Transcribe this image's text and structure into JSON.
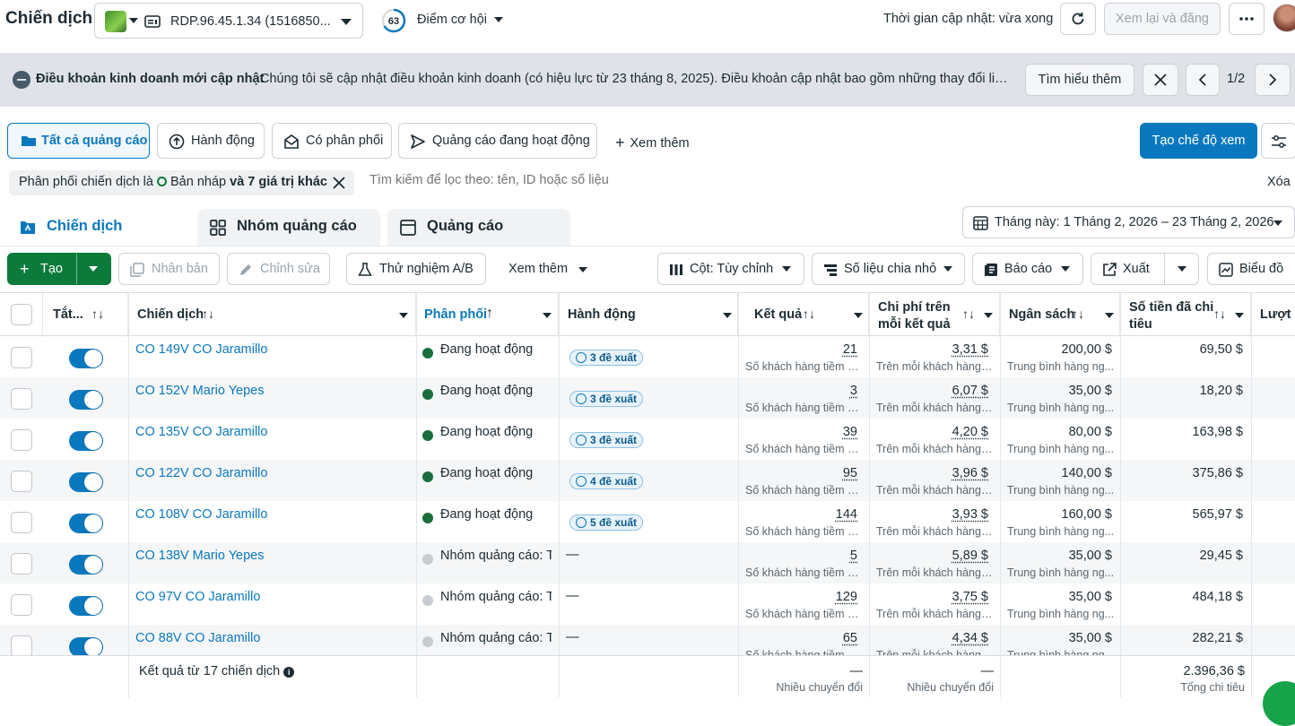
{
  "header": {
    "title": "Chiến dịch",
    "account_name": "RDP.96.45.1.34 (1516850...",
    "opportunity_score": "63",
    "opportunity_label": "Điểm cơ hội",
    "update_time": "Thời gian cập nhật: vừa xong",
    "review_publish_label": "Xem lại và đăng"
  },
  "notice": {
    "title": "Điều khoản kinh doanh mới cập nhật",
    "text": "Chúng tôi sẽ cập nhật điều khoản kinh doanh (có hiệu lực từ 23 tháng 8, 2025). Điều khoản cập nhật bao gồm những thay đổi liên q...",
    "learn_more": "Tìm hiểu thêm",
    "page": "1/2"
  },
  "views": {
    "all_ads": "Tất cả quảng cáo",
    "actions": "Hành động",
    "has_delivery": "Có phân phối",
    "active_ads": "Quảng cáo đang hoạt động",
    "see_more": "Xem thêm",
    "create_view": "Tạo chế độ xem"
  },
  "filter": {
    "prefix": "Phân phối chiến dịch là",
    "value": "Bản nháp",
    "suffix": "và 7 giá trị khác",
    "search_placeholder": "Tìm kiếm để lọc theo: tên, ID hoặc số liệu",
    "clear": "Xóa"
  },
  "tabs": {
    "campaigns": "Chiến dịch",
    "adsets": "Nhóm quảng cáo",
    "ads": "Quảng cáo",
    "date_range": "Tháng này: 1 Tháng 2, 2026 – 23 Tháng 2, 2026"
  },
  "toolbar": {
    "create": "Tạo",
    "duplicate": "Nhân bản",
    "edit": "Chỉnh sửa",
    "ab_test": "Thử nghiệm A/B",
    "see_more": "Xem thêm",
    "columns": "Cột: Tùy chỉnh",
    "breakdown": "Số liệu chia nhỏ",
    "reports": "Báo cáo",
    "export": "Xuất",
    "charts": "Biểu đồ"
  },
  "table": {
    "columns": {
      "toggle": "Tắt...",
      "campaign": "Chiến dịch",
      "delivery": "Phân phối",
      "actions": "Hành động",
      "results": "Kết quả",
      "cost_per_result_1": "Chi phí trên",
      "cost_per_result_2": "mỗi kết quả",
      "budget": "Ngân sách",
      "amount_spent_1": "Số tiền đã chi",
      "amount_spent_2": "tiêu",
      "reach": "Lượt"
    },
    "rows": [
      {
        "name": "CO 149V CO Jaramillo",
        "delivery": "Đang hoạt động",
        "status": "active",
        "recs": "3 đề xuất",
        "results": "21",
        "results_sub": "Số khách hàng tiềm n...",
        "cpr": "3,31 $",
        "cpr_sub": "Trên mỗi khách hàng ...",
        "budget": "200,00 $",
        "budget_sub": "Trung bình hàng ng...",
        "spent": "69,50 $"
      },
      {
        "name": "CO 152V Mario Yepes",
        "delivery": "Đang hoạt động",
        "status": "active",
        "recs": "3 đề xuất",
        "results": "3",
        "results_sub": "Số khách hàng tiềm n...",
        "cpr": "6,07 $",
        "cpr_sub": "Trên mỗi khách hàng ...",
        "budget": "35,00 $",
        "budget_sub": "Trung bình hàng ng...",
        "spent": "18,20 $"
      },
      {
        "name": "CO 135V CO Jaramillo",
        "delivery": "Đang hoạt động",
        "status": "active",
        "recs": "3 đề xuất",
        "results": "39",
        "results_sub": "Số khách hàng tiềm n...",
        "cpr": "4,20 $",
        "cpr_sub": "Trên mỗi khách hàng ...",
        "budget": "80,00 $",
        "budget_sub": "Trung bình hàng ng...",
        "spent": "163,98 $"
      },
      {
        "name": "CO 122V CO Jaramillo",
        "delivery": "Đang hoạt động",
        "status": "active",
        "recs": "4 đề xuất",
        "results": "95",
        "results_sub": "Số khách hàng tiềm n...",
        "cpr": "3,96 $",
        "cpr_sub": "Trên mỗi khách hàng ...",
        "budget": "140,00 $",
        "budget_sub": "Trung bình hàng ng...",
        "spent": "375,86 $"
      },
      {
        "name": "CO 108V CO Jaramillo",
        "delivery": "Đang hoạt động",
        "status": "active",
        "recs": "5 đề xuất",
        "results": "144",
        "results_sub": "Số khách hàng tiềm n...",
        "cpr": "3,93 $",
        "cpr_sub": "Trên mỗi khách hàng ...",
        "budget": "160,00 $",
        "budget_sub": "Trung bình hàng ng...",
        "spent": "565,97 $"
      },
      {
        "name": "CO 138V Mario Yepes",
        "delivery": "Nhóm quảng cáo: T",
        "status": "inactive",
        "recs": "—",
        "results": "5",
        "results_sub": "Số khách hàng tiềm n...",
        "cpr": "5,89 $",
        "cpr_sub": "Trên mỗi khách hàng ...",
        "budget": "35,00 $",
        "budget_sub": "Trung bình hàng ng...",
        "spent": "29,45 $"
      },
      {
        "name": "CO 97V CO Jaramillo",
        "delivery": "Nhóm quảng cáo: T",
        "status": "inactive",
        "recs": "—",
        "results": "129",
        "results_sub": "Số khách hàng tiềm n...",
        "cpr": "3,75 $",
        "cpr_sub": "Trên mỗi khách hàng ...",
        "budget": "35,00 $",
        "budget_sub": "Trung bình hàng ng...",
        "spent": "484,18 $"
      },
      {
        "name": "CO 88V CO Jaramillo",
        "delivery": "Nhóm quảng cáo: T",
        "status": "inactive",
        "recs": "—",
        "results": "65",
        "results_sub": "Số khách hàng tiềm n...",
        "cpr": "4,34 $",
        "cpr_sub": "Trên mỗi khách hàng ...",
        "budget": "35,00 $",
        "budget_sub": "Trung bình hàng ng...",
        "spent": "282,21 $"
      }
    ],
    "footer": {
      "label": "Kết quả từ 17 chiến dịch",
      "results": "—",
      "results_sub": "Nhiều chuyển đổi",
      "cpr": "—",
      "cpr_sub": "Nhiều chuyển đổi",
      "spent": "2.396,36 $",
      "spent_sub": "Tổng chi tiêu"
    }
  },
  "colors": {
    "primary": "#0a78be",
    "create_green": "#0c7a3a",
    "active_dot": "#1a6e3c",
    "inactive_dot": "#c8ccd0",
    "notice_bg": "#dfe3e8"
  }
}
